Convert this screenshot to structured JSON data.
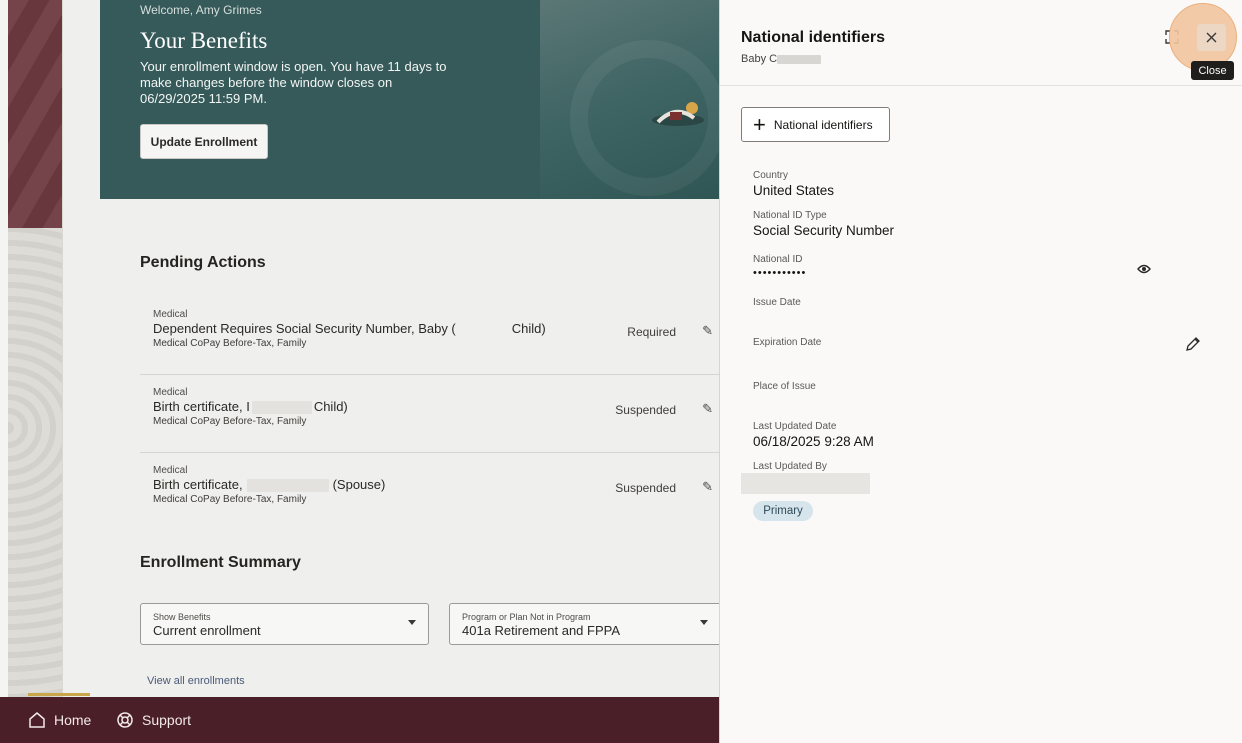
{
  "background": {
    "welcome_text": "Welcome, Amy Grimes",
    "hero_title": "Your Benefits",
    "hero_text": "Your enrollment window is open. You have 11 days to make changes before the window closes on 06/29/2025 11:59 PM.",
    "update_button_label": "Update Enrollment",
    "pending_actions_title": "Pending Actions",
    "pending_actions": [
      {
        "category": "Medical",
        "desc_before": "Dependent Requires Social Security Number, Baby (",
        "desc_after": "Child)",
        "plan": "Medical CoPay Before-Tax, Family",
        "status": "Required"
      },
      {
        "category": "Medical",
        "desc_before": "Birth certificate, I",
        "desc_after": "Child)",
        "plan": "Medical CoPay Before-Tax, Family",
        "status": "Suspended"
      },
      {
        "category": "Medical",
        "desc_before": "Birth certificate,",
        "desc_after": "(Spouse)",
        "plan": "Medical CoPay Before-Tax, Family",
        "status": "Suspended"
      }
    ],
    "enrollment_summary_title": "Enrollment Summary",
    "show_benefits_label": "Show Benefits",
    "show_benefits_value": "Current enrollment",
    "program_label": "Program or Plan Not in Program",
    "program_value": "401a Retirement and FPPA",
    "view_all_link": "View all enrollments",
    "nav": [
      {
        "label": "Home",
        "icon": "home-icon"
      },
      {
        "label": "Support",
        "icon": "support-icon"
      }
    ]
  },
  "drawer": {
    "title": "National identifiers",
    "subtitle": "Baby C",
    "close_tooltip": "Close",
    "add_button_label": "National identifiers",
    "fields": {
      "country_label": "Country",
      "country_value": "United States",
      "id_type_label": "National ID Type",
      "id_type_value": "Social Security Number",
      "national_id_label": "National ID",
      "national_id_value": "•••••••••••",
      "issue_date_label": "Issue Date",
      "expiration_date_label": "Expiration Date",
      "place_of_issue_label": "Place of Issue",
      "last_updated_date_label": "Last Updated Date",
      "last_updated_date_value": "06/18/2025 9:28 AM",
      "last_updated_by_label": "Last Updated By"
    },
    "primary_badge": "Primary"
  },
  "colors": {
    "hero_teal": "#355a59",
    "maroon": "#6e3a40",
    "nav_dark": "#4a1f27",
    "badge_blue": "#d6e5ec",
    "close_highlight": "#f2c6a0"
  }
}
